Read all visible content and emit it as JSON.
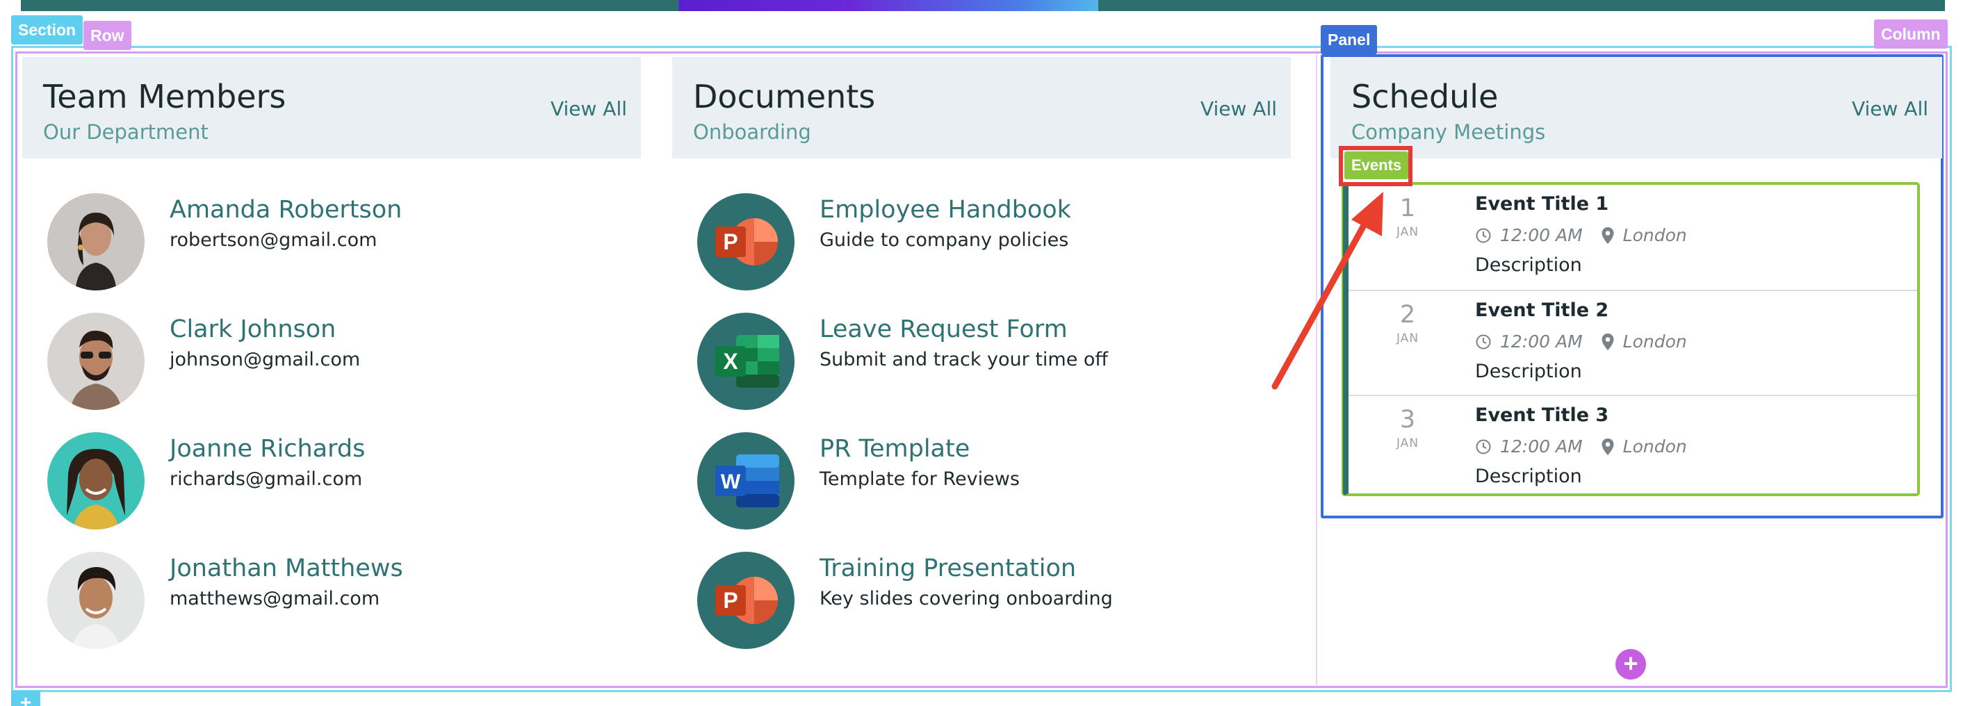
{
  "builder": {
    "section_tag": "Section",
    "row_tag": "Row",
    "panel_tag": "Panel",
    "column_tag": "Column",
    "events_tag": "Events",
    "add_symbol": "+"
  },
  "team": {
    "title": "Team Members",
    "subtitle": "Our Department",
    "view_all": "View All",
    "members": [
      {
        "name": "Amanda Robertson",
        "email": "robertson@gmail.com"
      },
      {
        "name": "Clark Johnson",
        "email": "johnson@gmail.com"
      },
      {
        "name": "Joanne Richards",
        "email": "richards@gmail.com"
      },
      {
        "name": "Jonathan Matthews",
        "email": "matthews@gmail.com"
      }
    ]
  },
  "documents": {
    "title": "Documents",
    "subtitle": "Onboarding",
    "view_all": "View All",
    "items": [
      {
        "title": "Employee Handbook",
        "desc": "Guide to company policies",
        "icon": "powerpoint-icon",
        "letter": "P"
      },
      {
        "title": "Leave Request Form",
        "desc": "Submit and track your time off",
        "icon": "excel-icon",
        "letter": "X"
      },
      {
        "title": "PR Template",
        "desc": "Template for Reviews",
        "icon": "word-icon",
        "letter": "W"
      },
      {
        "title": "Training Presentation",
        "desc": "Key slides covering onboarding",
        "icon": "powerpoint-icon",
        "letter": "P"
      }
    ]
  },
  "schedule": {
    "title": "Schedule",
    "subtitle": "Company Meetings",
    "view_all": "View All",
    "events": [
      {
        "day": "1",
        "month": "JAN",
        "title": "Event Title 1",
        "time": "12:00 AM",
        "location": "London",
        "desc": "Description"
      },
      {
        "day": "2",
        "month": "JAN",
        "title": "Event Title 2",
        "time": "12:00 AM",
        "location": "London",
        "desc": "Description"
      },
      {
        "day": "3",
        "month": "JAN",
        "title": "Event Title 3",
        "time": "12:00 AM",
        "location": "London",
        "desc": "Description"
      }
    ]
  },
  "colors": {
    "accent": "#2f7274",
    "section_outline": "#5ecfef",
    "row_outline": "#d99bf0",
    "panel_outline": "#3a6fd8",
    "events_outline": "#8cc63f",
    "highlight": "#e53935"
  }
}
